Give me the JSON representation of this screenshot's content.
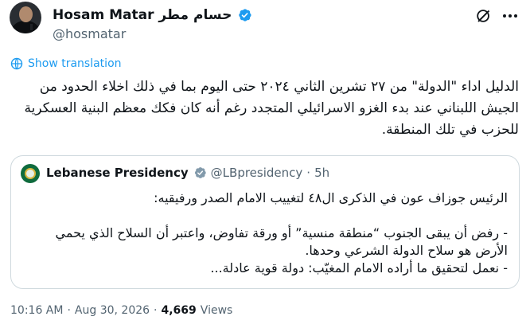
{
  "author": {
    "name_en": "Hosam Matar",
    "name_ar": "حسام مطر",
    "handle": "@hosmatar",
    "verified": true
  },
  "icons": {
    "grok": "grok-icon",
    "more": "more-icon",
    "translate": "translate-icon",
    "verified": "verified-badge-icon"
  },
  "colors": {
    "accent": "#1d9bf0",
    "text": "#0f1419",
    "muted": "#536471",
    "border": "#cfd9de",
    "verified_blue": "#1d9bf0",
    "verified_gray": "#829aab"
  },
  "translate": {
    "label": "Show translation"
  },
  "tweet": {
    "text": "الدليل اداء \"الدولة\" من ٢٧ تشرين الثاني ٢٠٢٤ حتى اليوم بما في ذلك اخلاء الحدود من الجيش اللبناني عند بدء الغزو الاسرائيلي المتجدد رغم أنه كان فكك معظم البنية العسكرية للحزب في تلك المنطقة."
  },
  "quote": {
    "name": "Lebanese Presidency",
    "handle": "@LBpresidency",
    "separator": "·",
    "time": "5h",
    "text": "الرئيس جوزاف عون في الذكرى ال٤٨ لتغييب الامام الصدر ورفيقيه:\n\n- رفض أن يبقى الجنوب “منطقة منسية” أو ورقة تفاوض، واعتبر أن السلاح الذي يحمي الأرض هو سلاح الدولة الشرعي وحدها.\n- نعمل لتحقيق ما أراده الامام المغيّب: دولة قوية عادلة..."
  },
  "footer": {
    "time": "10:16 AM",
    "separator1": "·",
    "date": "Aug 30, 2026",
    "separator2": "·",
    "views_count": "4,669",
    "views_label": "Views"
  }
}
